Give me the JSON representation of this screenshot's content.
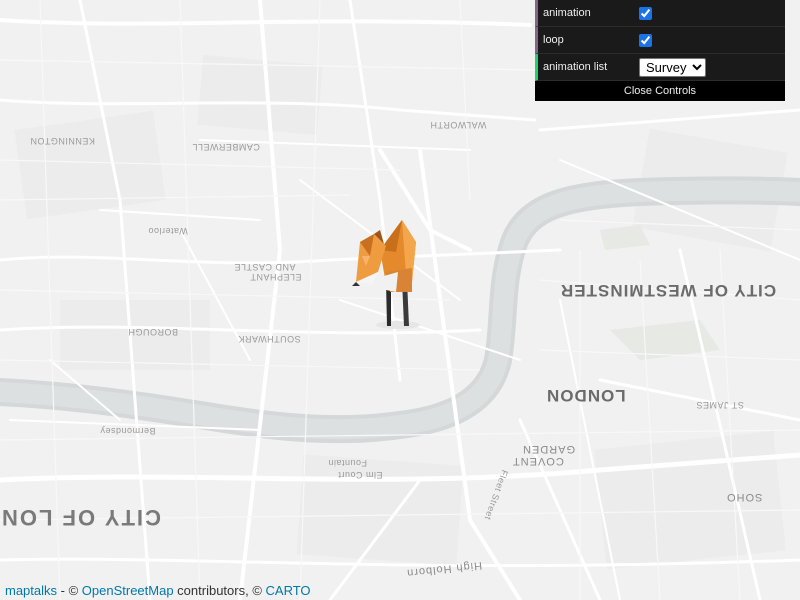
{
  "gui": {
    "animation_label": "animation",
    "animation_checked": true,
    "loop_label": "loop",
    "loop_checked": true,
    "animation_list_label": "animation list",
    "animation_list_selected": "Survey",
    "close_label": "Close Controls"
  },
  "attribution": {
    "maptalks": "maptalks",
    "sep1": " - © ",
    "osm": "OpenStreetMap",
    "contributors": " contributors, © ",
    "carto": "CARTO"
  },
  "map_labels": {
    "city_of_westminster": "CITY OF WESTMINSTER",
    "london": "LONDON",
    "city_of_london": "CITY OF LON",
    "covent_garden_1": "COVENT",
    "covent_garden_2": "GARDEN",
    "soho": "SOHO",
    "southwark": "SOUTHWARK",
    "borough": "BOROUGH",
    "camberwell": "CAMBERWELL",
    "st_james": "ST JAMES",
    "elephant_1": "ELEPHANT",
    "elephant_2": "AND CASTLE",
    "high_holborn": "High Holborn",
    "fleet_street": "Fleet Street",
    "elm_court": "Elm Court",
    "fountain": "Fountain",
    "kennington": "KENNINGTON",
    "walworth": "WALWORTH",
    "waterloo": "Waterloo",
    "bermondsey": "Bermondsey"
  },
  "colors": {
    "map_bg": "#f2f2f2",
    "river": "#d6dadb",
    "road": "#ffffff",
    "park": "#e8ebe6",
    "gui_bg": "#1a1a1a",
    "link": "#0078a8"
  }
}
